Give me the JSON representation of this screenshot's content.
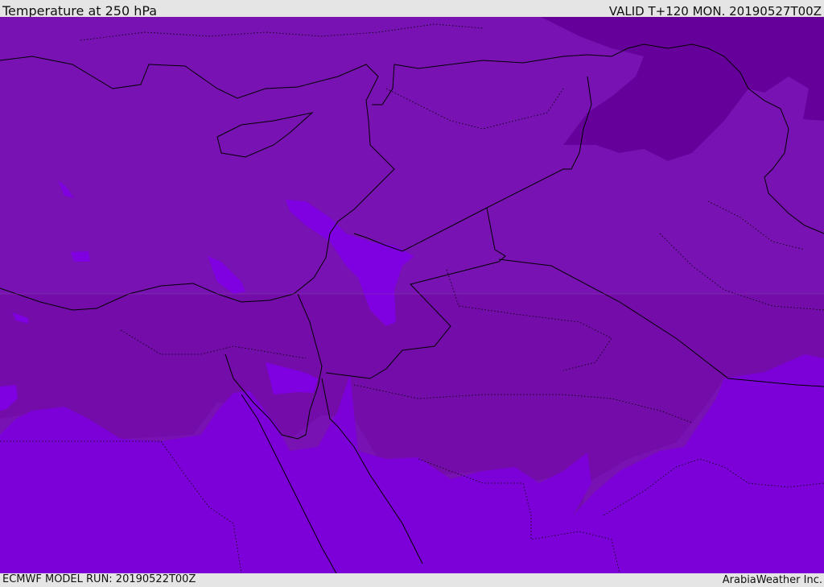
{
  "header": {
    "title": "Temperature at 250 hPa",
    "valid": "VALID T+120 MON. 20190527T00Z"
  },
  "footer": {
    "model_run": "ECMWF MODEL RUN: 20190522T00Z",
    "credit": "ArabiaWeather Inc."
  },
  "colors": {
    "background": "#e5e5e5",
    "temp_mid": "#7812b2",
    "temp_band": "#730ca8",
    "temp_warm": "#7c00d8",
    "temp_cold": "#66009a",
    "temp_light": "#7f00e0",
    "coastline": "#000000"
  }
}
